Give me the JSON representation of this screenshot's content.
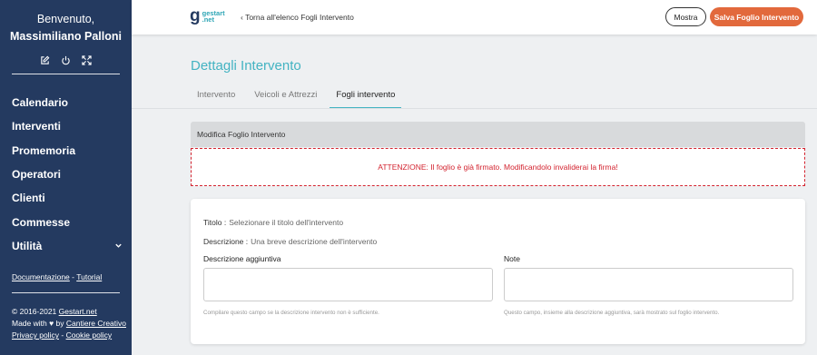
{
  "sidebar": {
    "greeting": "Benvenuto,",
    "user_name": "Massimiliano Palloni",
    "icons": [
      "edit-icon",
      "power-icon",
      "fullscreen-icon"
    ],
    "nav": [
      {
        "label": "Calendario"
      },
      {
        "label": "Interventi"
      },
      {
        "label": "Promemoria"
      },
      {
        "label": "Operatori"
      },
      {
        "label": "Clienti"
      },
      {
        "label": "Commesse"
      },
      {
        "label": "Utilità",
        "has_submenu": true
      }
    ],
    "doc_link": "Documentazione",
    "separator": "-",
    "tutorial_link": "Tutorial",
    "footer": {
      "copyright_prefix": "© 2016-2021",
      "copyright_link": "Gestart.net",
      "made_with_prefix": "Made with ♥ by",
      "made_with_link": "Cantiere Creativo",
      "privacy_link": "Privacy policy",
      "separator": "-",
      "cookie_link": "Cookie policy"
    }
  },
  "topbar": {
    "logo_mark": "g",
    "logo_line1": "gestart",
    "logo_line2": ".net",
    "back_arrow": "‹",
    "back_label": "Torna all'elenco Fogli Intervento",
    "show_button": "Mostra",
    "save_button": "Salva Foglio Intervento"
  },
  "main": {
    "title": "Dettagli Intervento",
    "tabs": [
      {
        "label": "Intervento",
        "active": false
      },
      {
        "label": "Veicoli e Attrezzi",
        "active": false
      },
      {
        "label": "Fogli intervento",
        "active": true
      }
    ],
    "section_header": "Modifica Foglio Intervento",
    "warning": "ATTENZIONE: Il foglio è già firmato. Modificandolo invaliderai la firma!",
    "form": {
      "title_label": "Titolo :",
      "title_value": "Selezionare il titolo dell'intervento",
      "description_label": "Descrizione :",
      "description_value": "Una breve descrizione dell'intervento",
      "extra_description_label": "Descrizione aggiuntiva",
      "extra_description_value": "",
      "extra_description_help": "Compilare questo campo se la descrizione intervento non è sufficiente.",
      "notes_label": "Note",
      "notes_value": "",
      "notes_help": "Questo campo, insieme alla descrizione aggiuntiva, sarà mostrato sul foglio intervento."
    }
  },
  "colors": {
    "sidebar_bg": "#243a60",
    "accent": "#43b3c2",
    "save_button": "#e2693c",
    "warning": "#d3232f"
  }
}
